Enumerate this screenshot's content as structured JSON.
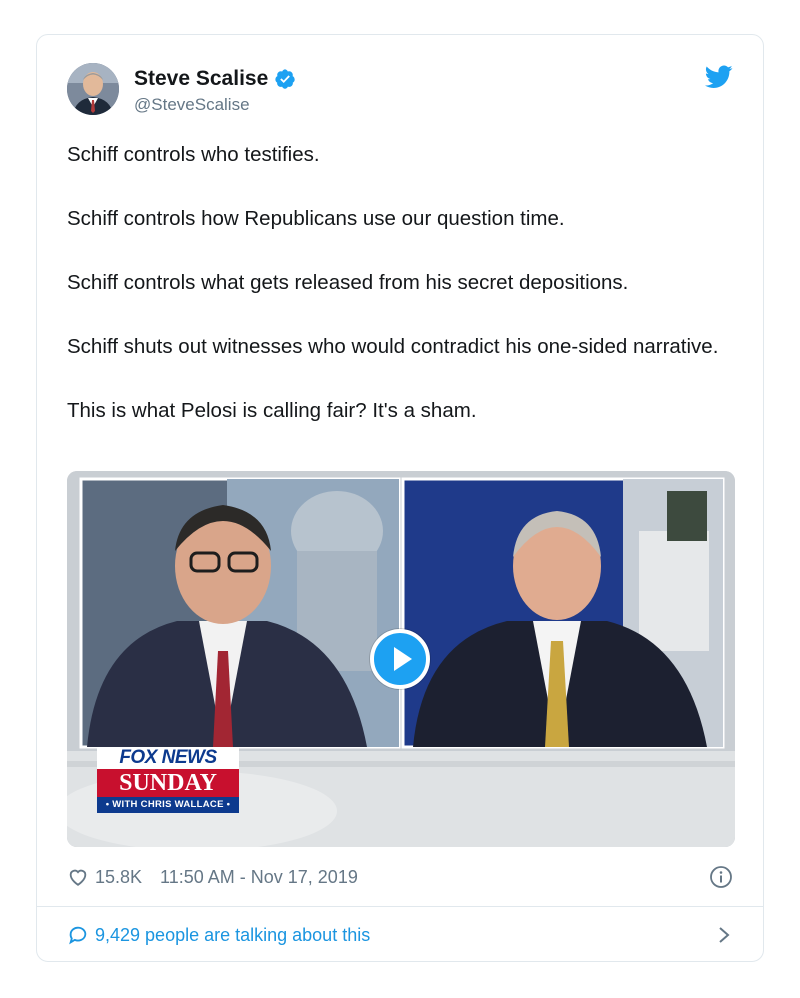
{
  "user": {
    "display_name": "Steve Scalise",
    "handle": "@SteveScalise",
    "verified": true
  },
  "tweet": {
    "paragraphs": [
      "Schiff controls who testifies.",
      "Schiff controls how Republicans use our question time.",
      "Schiff controls what gets released from his secret depositions.",
      "Schiff shuts out witnesses who would contradict his one-sided narrative.",
      "This is what Pelosi is calling fair? It's a sham."
    ]
  },
  "media": {
    "type": "video",
    "logo_line1": "FOX NEWS",
    "logo_line2": "SUNDAY",
    "logo_line3": "• WITH CHRIS WALLACE •"
  },
  "meta": {
    "likes": "15.8K",
    "timestamp": "11:50 AM - Nov 17, 2019"
  },
  "footer": {
    "talking": "9,429 people are talking about this"
  },
  "colors": {
    "accent": "#1da1f2",
    "link": "#1b95e0",
    "secondary_text": "#657786",
    "border": "#e1e8ed"
  }
}
